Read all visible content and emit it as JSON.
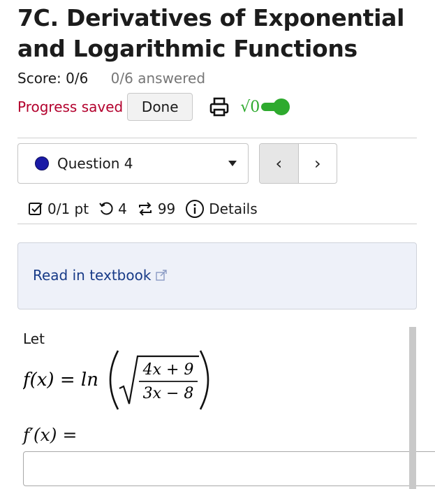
{
  "assignment": {
    "title": "7C. Derivatives of Exponential and Logarithmic Functions",
    "score": "Score: 0/6",
    "answered": "0/6 answered",
    "progress": "Progress saved",
    "done_label": "Done",
    "sqrt_label": "√0",
    "toggle_on": true
  },
  "question": {
    "selector_label": "Question 4",
    "status_color": "#1a1aa6",
    "prev_glyph": "‹",
    "next_glyph": "›",
    "points": "0/1 pt",
    "attempts": "4",
    "regenerations": "99",
    "details_label": "Details",
    "textbook_label": "Read in textbook",
    "let_label": "Let",
    "function_lhs": "f(x) = ln",
    "numerator": "4x + 9",
    "denominator": "3x − 8",
    "prompt": "f′(x) =",
    "answer_value": ""
  },
  "icons": {
    "print": "printer-icon",
    "points": "checkbox-icon",
    "attempts": "retry-icon",
    "regenerations": "regenerate-icon",
    "details": "info-icon",
    "external": "external-link-icon"
  },
  "colors": {
    "progress": "#b3002d",
    "toggle": "#2eaa2e",
    "link": "#173a87",
    "panel": "#eef1f9"
  }
}
